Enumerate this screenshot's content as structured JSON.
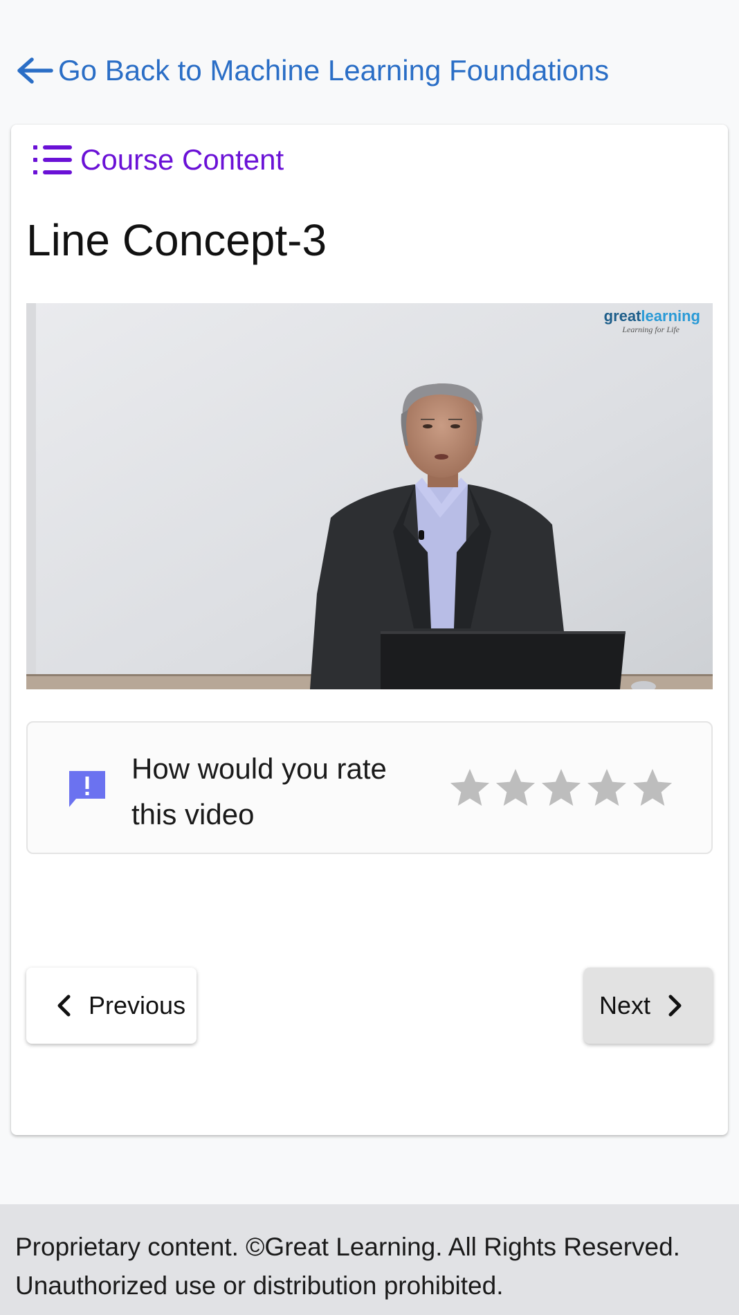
{
  "back_link": {
    "label": "Go Back to Machine Learning Foundations",
    "icon": "arrow-left-icon"
  },
  "course_content": {
    "label": "Course Content",
    "icon": "list-icon"
  },
  "lesson": {
    "title": "Line Concept-3"
  },
  "video": {
    "brand_name_part1": "great",
    "brand_name_part2": "learning",
    "brand_tagline": "Learning for Life"
  },
  "rating": {
    "question": "How would you rate this video",
    "icon": "feedback-icon",
    "max_stars": 5,
    "current_rating": 0
  },
  "navigation": {
    "previous_label": "Previous",
    "next_label": "Next"
  },
  "footer": {
    "line1": "Proprietary content. ©Great Learning. All Rights Reserved.",
    "line2": "Unauthorized use or distribution prohibited."
  },
  "colors": {
    "link_blue": "#2a6ec6",
    "accent_purple": "#6a11d6",
    "feedback_icon": "#6b72f0",
    "star_inactive": "#bdbdbd"
  }
}
